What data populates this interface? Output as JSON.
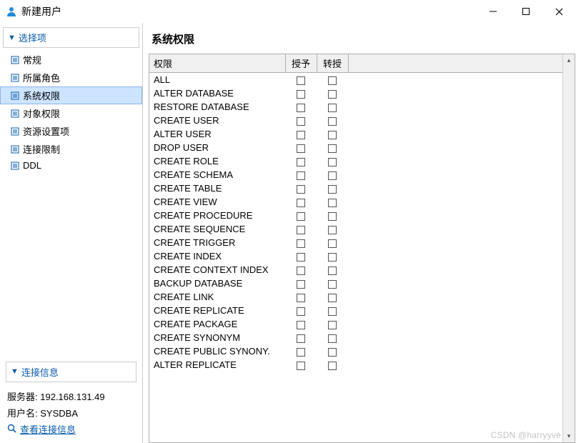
{
  "window": {
    "title": "新建用户"
  },
  "sidebar": {
    "options_header": "选择项",
    "items": [
      {
        "label": "常规"
      },
      {
        "label": "所属角色"
      },
      {
        "label": "系统权限"
      },
      {
        "label": "对象权限"
      },
      {
        "label": "资源设置项"
      },
      {
        "label": "连接限制"
      },
      {
        "label": "DDL"
      }
    ],
    "connection_header": "连接信息",
    "server_label": "服务器:",
    "server_value": "192.168.131.49",
    "user_label": "用户名:",
    "user_value": "SYSDBA",
    "view_connection_link": "查看连接信息"
  },
  "main": {
    "title": "系统权限",
    "columns": {
      "priv": "权限",
      "grant": "授予",
      "trans": "转授"
    },
    "rows": [
      "ALL",
      "ALTER DATABASE",
      "RESTORE DATABASE",
      "CREATE USER",
      "ALTER USER",
      "DROP USER",
      "CREATE ROLE",
      "CREATE SCHEMA",
      "CREATE TABLE",
      "CREATE VIEW",
      "CREATE PROCEDURE",
      "CREATE SEQUENCE",
      "CREATE TRIGGER",
      "CREATE INDEX",
      "CREATE CONTEXT INDEX",
      "BACKUP DATABASE",
      "CREATE LINK",
      "CREATE REPLICATE",
      "CREATE PACKAGE",
      "CREATE SYNONYM",
      "CREATE PUBLIC SYNONY.",
      "ALTER REPLICATE"
    ]
  },
  "watermark": "CSDN @harryyve"
}
